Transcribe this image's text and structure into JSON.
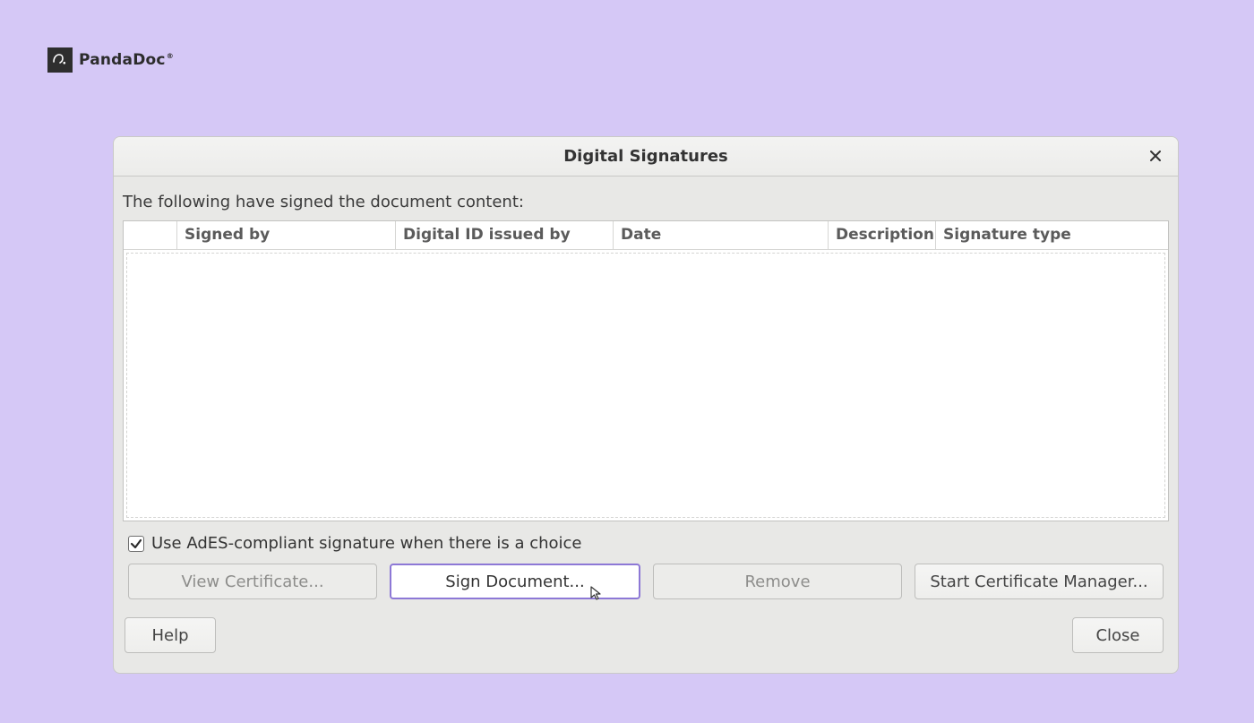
{
  "brand": {
    "name": "PandaDoc"
  },
  "dialog": {
    "title": "Digital Signatures",
    "intro": "The following have signed the document content:",
    "columns": {
      "signed_by": "Signed by",
      "digital_id": "Digital ID issued by",
      "date": "Date",
      "description": "Description",
      "signature_type": "Signature type"
    },
    "checkbox": {
      "checked": true,
      "label": "Use AdES-compliant signature when there is a choice"
    },
    "buttons": {
      "view_certificate": "View Certificate...",
      "sign_document": "Sign Document...",
      "remove": "Remove",
      "start_cert_manager": "Start Certificate Manager...",
      "help": "Help",
      "close": "Close"
    }
  }
}
